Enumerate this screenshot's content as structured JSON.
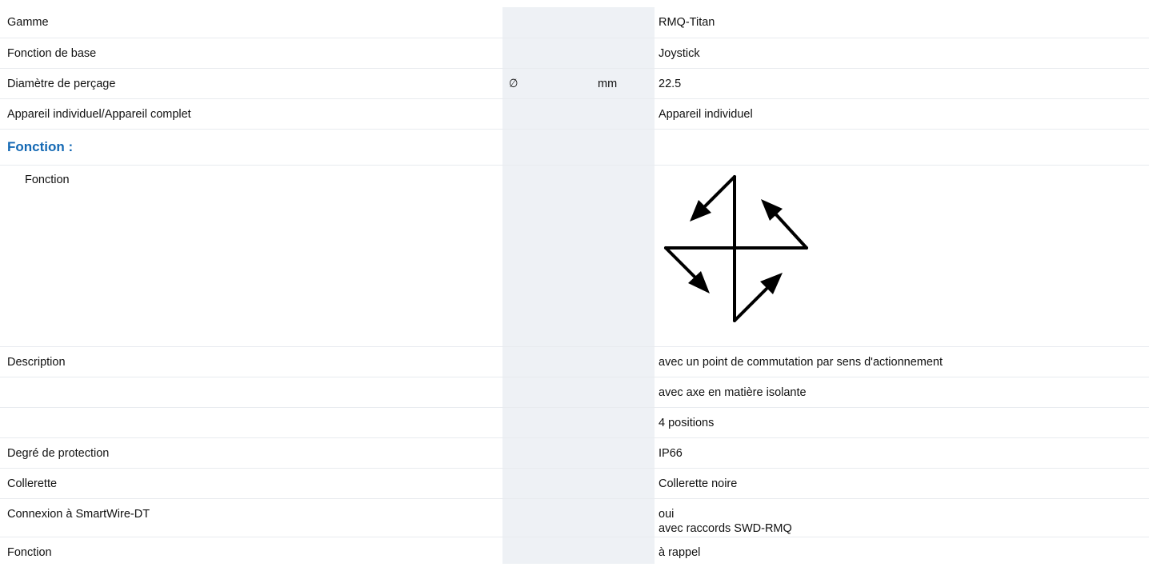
{
  "rows": [
    {
      "label": "Gamme",
      "value": "RMQ-Titan"
    },
    {
      "label": "Fonction de base",
      "value": "Joystick"
    },
    {
      "label": "Diamètre de perçage",
      "symbol": "∅",
      "unit": "mm",
      "value": "22.5"
    },
    {
      "label": "Appareil individuel/Appareil complet",
      "value": "Appareil individuel"
    }
  ],
  "section": {
    "title": "Fonction :",
    "item_label": "Fonction"
  },
  "rows2": [
    {
      "label": "Description",
      "value": "avec un point de commutation par sens d'actionnement"
    },
    {
      "label": "",
      "value": "avec axe en matière isolante"
    },
    {
      "label": "",
      "value": "4 positions"
    },
    {
      "label": "Degré de protection",
      "value": "IP66"
    },
    {
      "label": "Collerette",
      "value": "Collerette noire"
    },
    {
      "label": "Connexion à SmartWire-DT",
      "value": "oui",
      "value2": "avec raccords SWD-RMQ"
    },
    {
      "label": "Fonction",
      "value": "à rappel"
    }
  ],
  "icon": {
    "name": "joystick-four-direction-symbol",
    "color": "#000000"
  },
  "colors": {
    "heading": "#1469b4",
    "shaded_column": "#eef1f5"
  }
}
